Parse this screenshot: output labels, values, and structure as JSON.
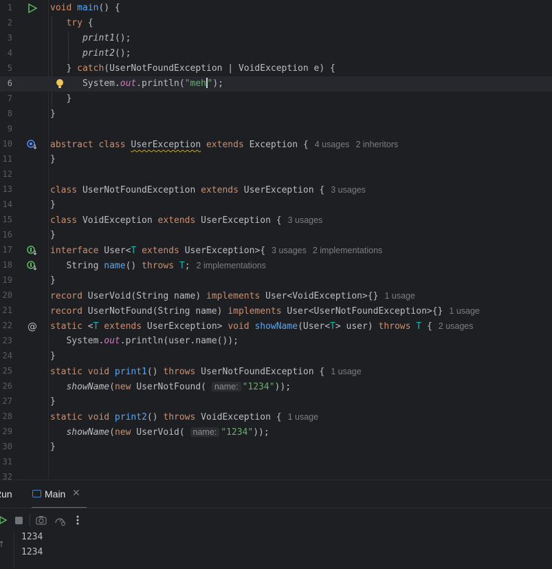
{
  "editor": {
    "lines": [
      {
        "n": "1"
      },
      {
        "n": "2"
      },
      {
        "n": "3"
      },
      {
        "n": "4"
      },
      {
        "n": "5"
      },
      {
        "n": "6"
      },
      {
        "n": "7"
      },
      {
        "n": "8"
      },
      {
        "n": "9"
      },
      {
        "n": "10"
      },
      {
        "n": "11"
      },
      {
        "n": "12"
      },
      {
        "n": "13"
      },
      {
        "n": "14"
      },
      {
        "n": "15"
      },
      {
        "n": "16"
      },
      {
        "n": "17"
      },
      {
        "n": "18"
      },
      {
        "n": "19"
      },
      {
        "n": "20"
      },
      {
        "n": "21"
      },
      {
        "n": "22"
      },
      {
        "n": "23"
      },
      {
        "n": "24"
      },
      {
        "n": "25"
      },
      {
        "n": "26"
      },
      {
        "n": "27"
      },
      {
        "n": "28"
      },
      {
        "n": "29"
      },
      {
        "n": "30"
      },
      {
        "n": "31"
      },
      {
        "n": "32"
      }
    ],
    "current_line": "6",
    "hints": {
      "l10_usages": "4 usages",
      "l10_inheritors": "2 inheritors",
      "l13": "3 usages",
      "l15": "3 usages",
      "l17_usages": "3 usages",
      "l17_impl": "2 implementations",
      "l18": "2 implementations",
      "l20": "1 usage",
      "l21": "1 usage",
      "l22": "2 usages",
      "l25": "1 usage",
      "l28": "1 usage",
      "param_name": "name:"
    },
    "strings": {
      "meh_a": "\"meh",
      "meh_b": "\"",
      "s1234": "\"1234\""
    }
  },
  "run_panel": {
    "run_label": "Run",
    "tab_label": "Main",
    "output": [
      "1234",
      "1234"
    ]
  },
  "colors": {
    "background": "#1e1f22",
    "keyword": "#cf8e6d",
    "function": "#56a8f5",
    "string": "#6aab73",
    "accent": "#3574f0"
  },
  "icons": [
    "run-gutter-icon",
    "lightbulb-icon",
    "overridden-icon",
    "implemented-icon",
    "annotation-at-icon",
    "close-icon",
    "rerun-icon",
    "stop-icon",
    "camera-icon",
    "profiler-icon",
    "more-icon",
    "scroll-up-icon"
  ]
}
